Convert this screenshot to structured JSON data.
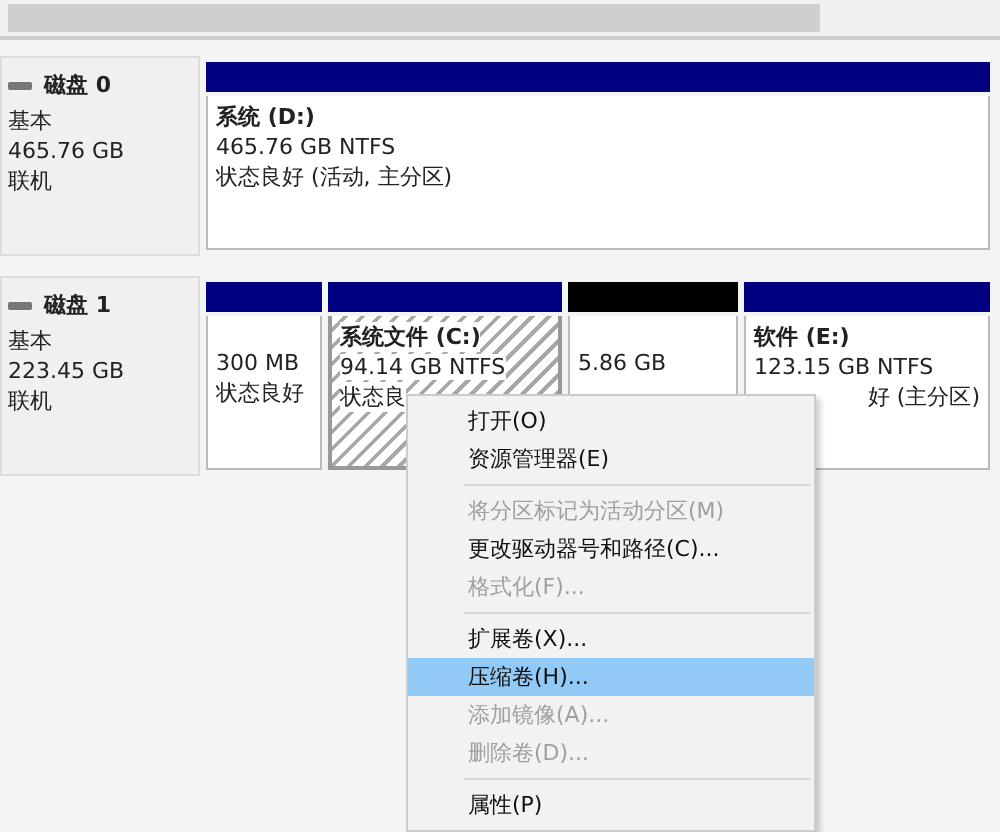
{
  "disks": [
    {
      "name": "磁盘 0",
      "type": "基本",
      "size": "465.76 GB",
      "status": "联机",
      "partitions": [
        {
          "kind": "primary",
          "label": "系统 (D:)",
          "size": "465.76 GB NTFS",
          "status": "状态良好 (活动, 主分区)",
          "selected": false
        }
      ]
    },
    {
      "name": "磁盘 1",
      "type": "基本",
      "size": "223.45 GB",
      "status": "联机",
      "partitions": [
        {
          "kind": "primary",
          "size": "300 MB",
          "status": "状态良好",
          "selected": false
        },
        {
          "kind": "primary",
          "label": "系统文件 (C:)",
          "size": "94.14 GB NTFS",
          "status": "状态良",
          "selected": true
        },
        {
          "kind": "unallocated",
          "size": "5.86 GB",
          "selected": false
        },
        {
          "kind": "primary",
          "label": "软件 (E:)",
          "size": "123.15 GB NTFS",
          "status": "好 (主分区)",
          "selected": false
        }
      ]
    }
  ],
  "context_menu": {
    "items": [
      {
        "kind": "item",
        "label": "打开(O)",
        "disabled": false,
        "selected": false
      },
      {
        "kind": "item",
        "label": "资源管理器(E)",
        "disabled": false,
        "selected": false
      },
      {
        "kind": "separator"
      },
      {
        "kind": "item",
        "label": "将分区标记为活动分区(M)",
        "disabled": true,
        "selected": false
      },
      {
        "kind": "item",
        "label": "更改驱动器号和路径(C)...",
        "disabled": false,
        "selected": false
      },
      {
        "kind": "item",
        "label": "格式化(F)...",
        "disabled": true,
        "selected": false
      },
      {
        "kind": "separator"
      },
      {
        "kind": "item",
        "label": "扩展卷(X)...",
        "disabled": false,
        "selected": false
      },
      {
        "kind": "item",
        "label": "压缩卷(H)...",
        "disabled": false,
        "selected": true
      },
      {
        "kind": "item",
        "label": "添加镜像(A)...",
        "disabled": true,
        "selected": false
      },
      {
        "kind": "item",
        "label": "删除卷(D)...",
        "disabled": true,
        "selected": false
      },
      {
        "kind": "separator"
      },
      {
        "kind": "item",
        "label": "属性(P)",
        "disabled": false,
        "selected": false
      }
    ]
  }
}
